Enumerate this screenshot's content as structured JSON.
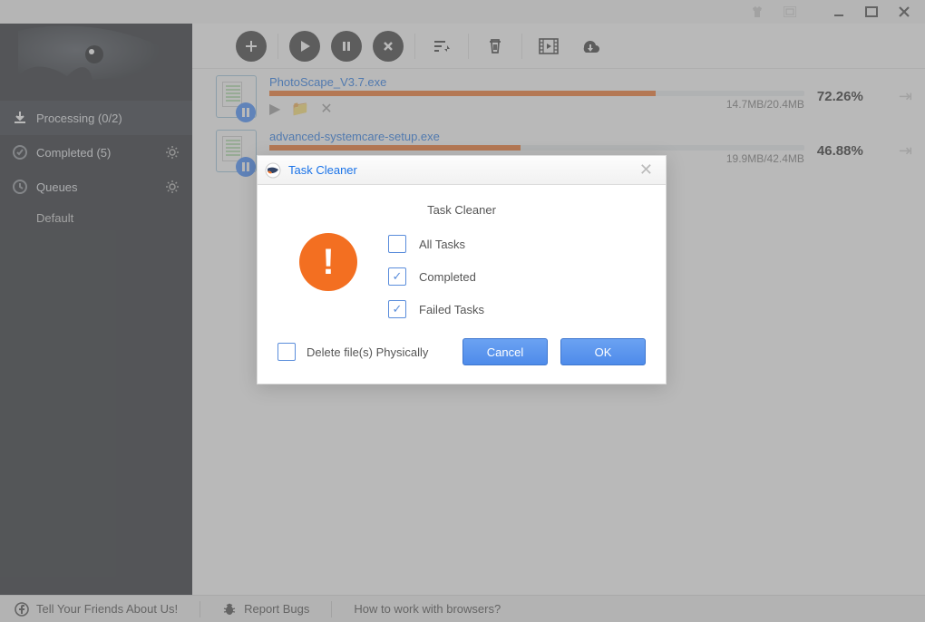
{
  "sidebar": {
    "processing": "Processing (0/2)",
    "completed": "Completed (5)",
    "queues": "Queues",
    "default": "Default"
  },
  "downloads": [
    {
      "name": "PhotoScape_V3.7.exe",
      "progress": 72.26,
      "downloaded": "14.7MB",
      "total": "20.4MB",
      "percent": "72.26%"
    },
    {
      "name": "advanced-systemcare-setup.exe",
      "progress": 46.88,
      "downloaded": "19.9MB",
      "total": "42.4MB",
      "percent": "46.88%"
    }
  ],
  "modal": {
    "title": "Task Cleaner",
    "heading": "Task Cleaner",
    "opts": {
      "all": "All Tasks",
      "completed": "Completed",
      "failed": "Failed Tasks"
    },
    "deletePhys": "Delete file(s) Physically",
    "cancel": "Cancel",
    "ok": "OK"
  },
  "status": {
    "tell": "Tell Your Friends About Us!",
    "bugs": "Report Bugs",
    "browsers": "How to work with browsers?"
  }
}
